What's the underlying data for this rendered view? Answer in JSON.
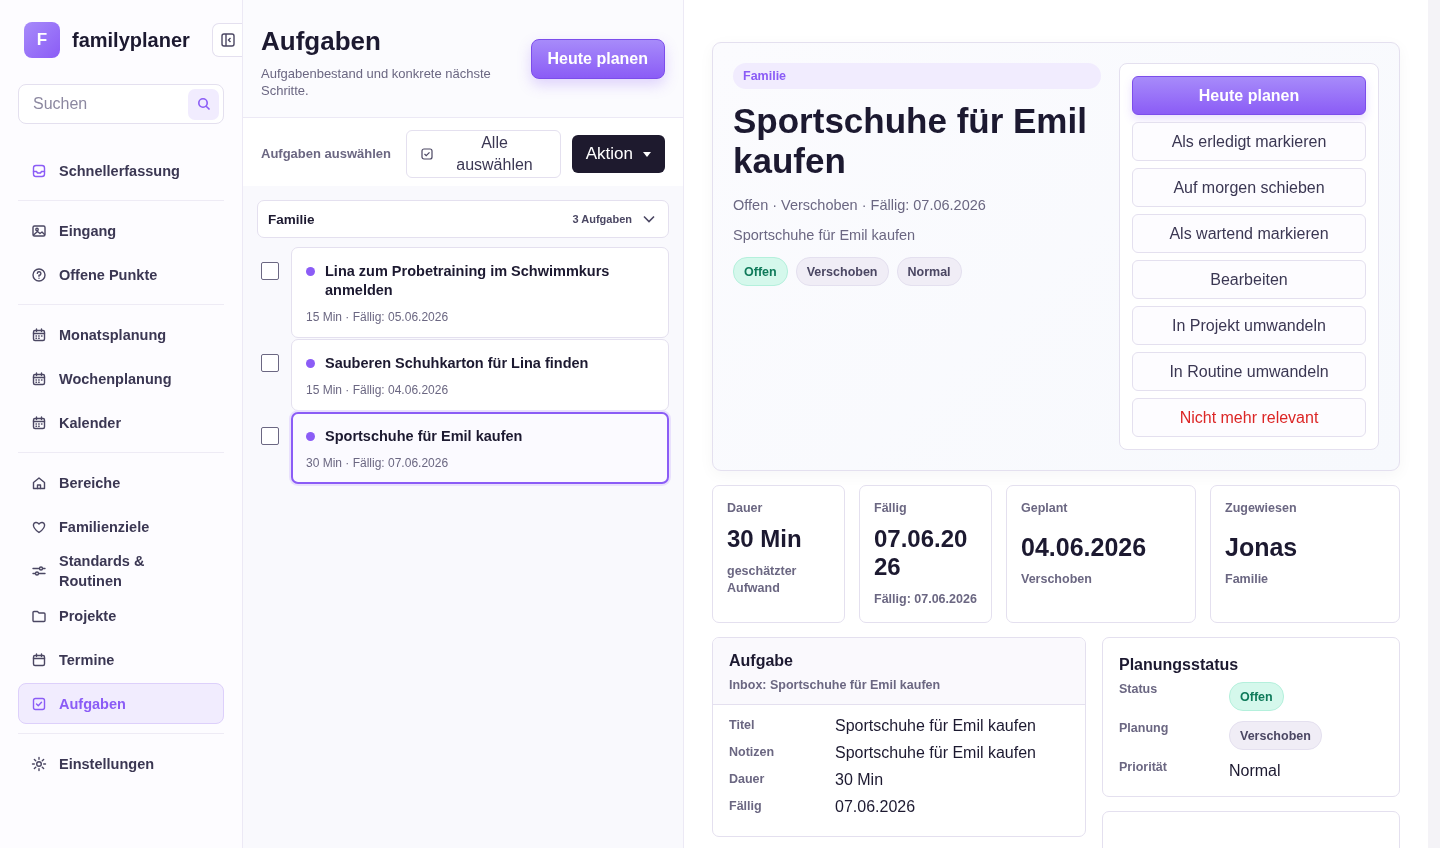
{
  "brand": {
    "initial": "F",
    "name": "familyplaner"
  },
  "search": {
    "placeholder": "Suchen"
  },
  "nav": [
    {
      "items": [
        {
          "label": "Schnellerfassung",
          "selected": false
        }
      ]
    },
    {
      "items": [
        {
          "label": "Eingang",
          "selected": false
        },
        {
          "label": "Offene Punkte",
          "selected": false
        }
      ]
    },
    {
      "items": [
        {
          "label": "Monatsplanung",
          "selected": false
        },
        {
          "label": "Wochenplanung",
          "selected": false
        },
        {
          "label": "Kalender",
          "selected": false
        }
      ]
    },
    {
      "items": [
        {
          "label": "Bereiche",
          "selected": false
        },
        {
          "label": "Familienziele",
          "selected": false
        },
        {
          "label": "Standards & Routinen",
          "selected": false
        },
        {
          "label": "Projekte",
          "selected": false
        },
        {
          "label": "Termine",
          "selected": false
        },
        {
          "label": "Aufgaben",
          "selected": true
        }
      ]
    },
    {
      "items": [
        {
          "label": "Einstellungen",
          "selected": false
        }
      ]
    }
  ],
  "list_panel": {
    "title": "Aufgaben",
    "subtitle": "Aufgabenbestand und konkrete nächste Schritte.",
    "primary_button": "Heute planen",
    "select_label": "Aufgaben auswählen",
    "select_all_button": "Alle auswählen",
    "action_button": "Aktion",
    "group": {
      "name": "Familie",
      "count": "3 Aufgaben",
      "expanded": true,
      "tasks": [
        {
          "title": "Lina zum Probetraining im Schwimmkurs anmelden",
          "meta": "15 Min · Fällig: 05.06.2026",
          "checked": false,
          "selected": false
        },
        {
          "title": "Sauberen Schuhkarton für Lina finden",
          "meta": "15 Min · Fällig: 04.06.2026",
          "checked": false,
          "selected": false
        },
        {
          "title": "Sportschuhe für Emil kaufen",
          "meta": "30 Min · Fällig: 07.06.2026",
          "checked": false,
          "selected": true
        }
      ]
    }
  },
  "detail": {
    "category": "Familie",
    "title": "Sportschuhe für Emil kaufen",
    "meta": "Offen · Verschoben · Fällig: 07.06.2026",
    "note": "Sportschuhe für Emil kaufen",
    "tags": [
      {
        "label": "Offen",
        "kind": "success"
      },
      {
        "label": "Verschoben",
        "kind": "neutral"
      },
      {
        "label": "Normal",
        "kind": "neutral"
      }
    ],
    "actions": [
      {
        "label": "Heute planen",
        "kind": "primary"
      },
      {
        "label": "Als erledigt markieren",
        "kind": "default"
      },
      {
        "label": "Auf morgen schieben",
        "kind": "default"
      },
      {
        "label": "Als wartend markieren",
        "kind": "default"
      },
      {
        "label": "Bearbeiten",
        "kind": "default"
      },
      {
        "label": "In Projekt umwandeln",
        "kind": "default"
      },
      {
        "label": "In Routine umwandeln",
        "kind": "default"
      },
      {
        "label": "Nicht mehr relevant",
        "kind": "danger"
      }
    ]
  },
  "stats": [
    {
      "label": "Dauer",
      "value": "30 Min",
      "caption": "geschätzter Aufwand"
    },
    {
      "label": "Fällig",
      "value": "07.06.2026",
      "caption": "Fällig: 07.06.2026"
    },
    {
      "label": "Geplant",
      "value": "04.06.2026",
      "caption": "Verschoben"
    },
    {
      "label": "Zugewiesen",
      "value": "Jonas",
      "caption": "Familie"
    }
  ],
  "task_card": {
    "title": "Aufgabe",
    "subtitle": "Inbox: Sportschuhe für Emil kaufen",
    "fields": [
      {
        "label": "Titel",
        "value": "Sportschuhe für Emil kaufen"
      },
      {
        "label": "Notizen",
        "value": "Sportschuhe für Emil kaufen"
      },
      {
        "label": "Dauer",
        "value": "30 Min"
      },
      {
        "label": "Fällig",
        "value": "07.06.2026"
      }
    ]
  },
  "planning": {
    "title": "Planungsstatus",
    "rows": [
      {
        "label": "Status",
        "value": "Offen",
        "kind": "success"
      },
      {
        "label": "Planung",
        "value": "Verschoben",
        "kind": "neutral"
      },
      {
        "label": "Priorität",
        "value": "Normal",
        "kind": "text"
      }
    ]
  }
}
